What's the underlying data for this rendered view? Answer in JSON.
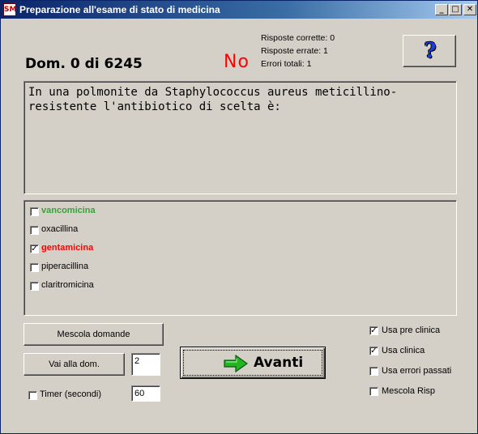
{
  "window": {
    "title": "Preparazione all'esame di stato di medicina",
    "app_icon_text": "SM"
  },
  "titlebar_buttons": {
    "minimize": "_",
    "maximize": "□",
    "close": "✕"
  },
  "question_counter": "Dom. 0 di 6245",
  "result_label": "No",
  "stats": {
    "correct": "Risposte corrette: 0",
    "wrong": "Risposte errate: 1",
    "total_errors": "Errori totali: 1"
  },
  "help_button": {
    "icon": "question-icon",
    "glyph": "?"
  },
  "question_text": "In una polmonite da Staphylococcus aureus meticillino-resistente l'antibiotico di scelta è:",
  "answers": [
    {
      "label": "vancomicina",
      "checked": false,
      "status": "correct",
      "color": "#3ca03c"
    },
    {
      "label": "oxacillina",
      "checked": false,
      "status": "normal",
      "color": "#000000"
    },
    {
      "label": "gentamicina",
      "checked": true,
      "status": "wrong",
      "color": "#ff0000"
    },
    {
      "label": "piperacillina",
      "checked": false,
      "status": "normal",
      "color": "#000000"
    },
    {
      "label": "claritromicina",
      "checked": false,
      "status": "normal",
      "color": "#000000"
    }
  ],
  "buttons": {
    "shuffle_questions": "Mescola domande",
    "goto_question": "Vai alla dom.",
    "next": "Avanti"
  },
  "goto_value": "2",
  "timer": {
    "label": "Timer (secondi)",
    "checked": false,
    "value": "60"
  },
  "options": [
    {
      "label": "Usa pre clinica",
      "checked": true
    },
    {
      "label": "Usa clinica",
      "checked": true
    },
    {
      "label": "Usa errori passati",
      "checked": false
    },
    {
      "label": "Mescola Risp",
      "checked": false
    }
  ],
  "colors": {
    "background": "#d4d0c8",
    "titlebar": "#0a246a",
    "correct": "#3ca03c",
    "wrong": "#ff0000",
    "next_arrow": "#22b422"
  }
}
